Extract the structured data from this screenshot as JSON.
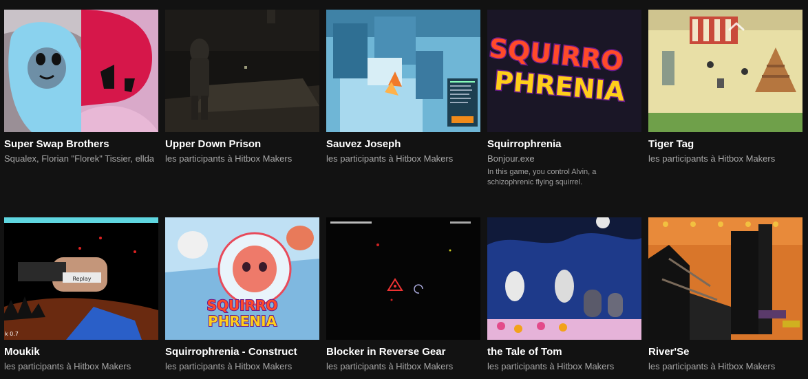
{
  "games": [
    {
      "title": "Super Swap Brothers",
      "author": "Squalex, Florian \"Florek\" Tissier, ellda",
      "description": ""
    },
    {
      "title": "Upper Down Prison",
      "author": "les participants à Hitbox Makers",
      "description": ""
    },
    {
      "title": "Sauvez Joseph",
      "author": "les participants à Hitbox Makers",
      "description": ""
    },
    {
      "title": "Squirrophrenia",
      "author": "Bonjour.exe",
      "description": "In this game, you control Alvin, a schizophrenic flying squirrel."
    },
    {
      "title": "Tiger Tag",
      "author": "les participants à Hitbox Makers",
      "description": ""
    },
    {
      "title": "Moukik",
      "author": "les participants à Hitbox Makers",
      "description": ""
    },
    {
      "title": "Squirrophrenia - Construct",
      "author": "les participants à Hitbox Makers",
      "description": ""
    },
    {
      "title": "Blocker in Reverse Gear",
      "author": "les participants à Hitbox Makers",
      "description": ""
    },
    {
      "title": "the Tale of Tom",
      "author": "les participants à Hitbox Makers",
      "description": ""
    },
    {
      "title": "River'Se",
      "author": "les participants à Hitbox Makers",
      "description": ""
    }
  ],
  "thumb_text": {
    "squirro_logo_line1": "SQUIRRO",
    "squirro_logo_line2": "PHRENIA",
    "moukik_replay": "Replay",
    "moukik_version": "k 0.7"
  },
  "icons": {
    "scroll_up": "chevron-up-icon"
  }
}
